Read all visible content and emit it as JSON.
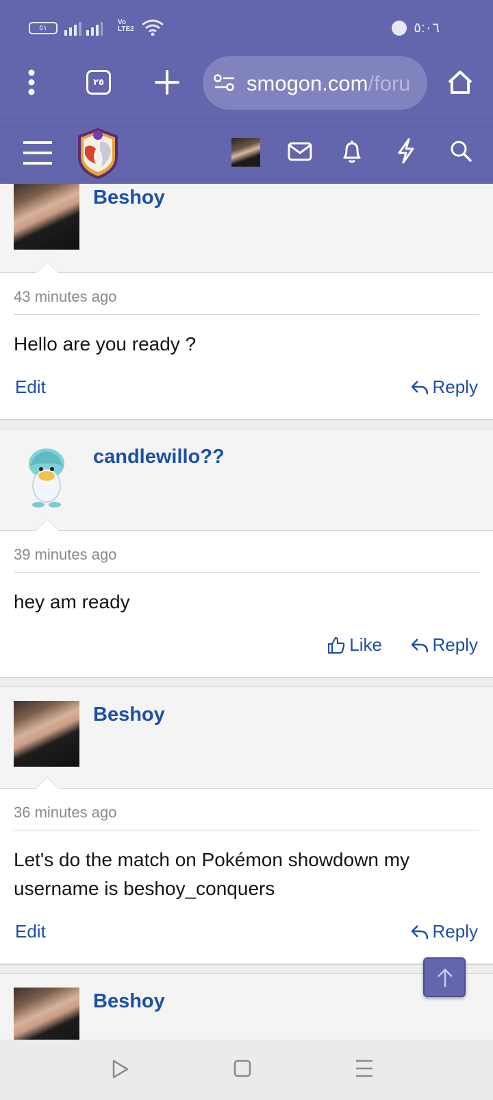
{
  "status_bar": {
    "battery": "٥١",
    "network_label": "Vo LTE2",
    "time": "٥:٠٦"
  },
  "browser": {
    "tab_count": "٢٥",
    "url_main": "smogon.com",
    "url_faded": "/foru"
  },
  "forum_nav": {
    "icons": [
      "menu-icon",
      "site-logo",
      "user-avatar",
      "inbox-icon",
      "alerts-icon",
      "whats-new-icon",
      "search-icon"
    ]
  },
  "posts": [
    {
      "username": "Beshoy",
      "timestamp": "43 minutes ago",
      "content": "Hello are you ready ?",
      "left_action": "Edit",
      "right_action": "Reply"
    },
    {
      "username": "candlewillo??",
      "timestamp": "39 minutes ago",
      "content": "hey am ready",
      "left_action": "Like",
      "right_action": "Reply"
    },
    {
      "username": "Beshoy",
      "timestamp": "36 minutes ago",
      "content": "Let's do the match on Pokémon showdown my username is beshoy_conquers",
      "left_action": "Edit",
      "right_action": "Reply"
    },
    {
      "username": "Beshoy"
    }
  ],
  "colors": {
    "header": "#6365ad",
    "link": "#1c4fa8",
    "meta": "#8a8a8a"
  }
}
